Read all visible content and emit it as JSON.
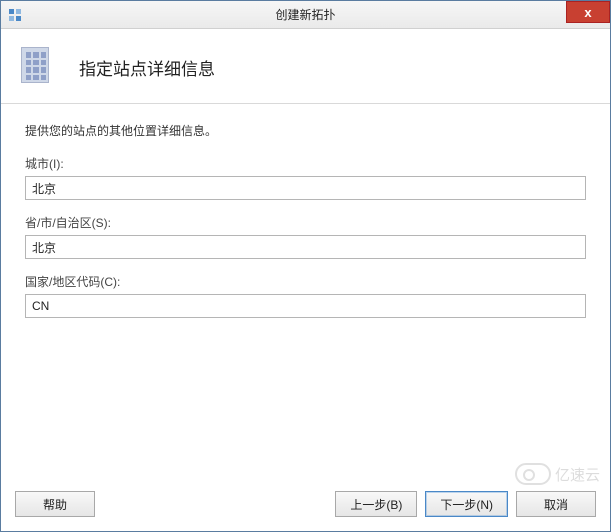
{
  "window": {
    "title": "创建新拓扑",
    "close_label": "x"
  },
  "header": {
    "title": "指定站点详细信息"
  },
  "content": {
    "instruction": "提供您的站点的其他位置详细信息。",
    "city": {
      "label": "城市(I):",
      "value": "北京"
    },
    "province": {
      "label": "省/市/自治区(S):",
      "value": "北京"
    },
    "country": {
      "label": "国家/地区代码(C):",
      "value": "CN"
    }
  },
  "footer": {
    "help": "帮助",
    "back": "上一步(B)",
    "next": "下一步(N)",
    "cancel": "取消"
  },
  "watermark": {
    "text": "亿速云"
  }
}
